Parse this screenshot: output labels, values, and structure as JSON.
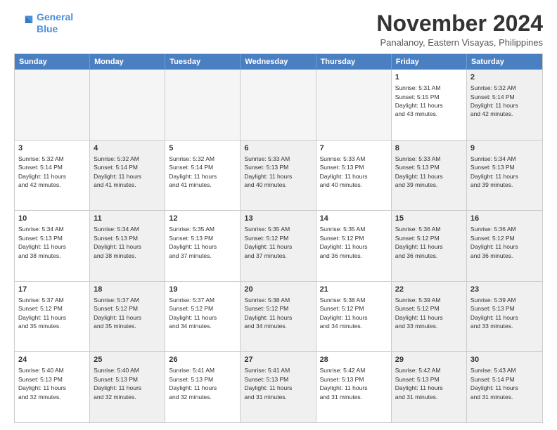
{
  "logo": {
    "line1": "General",
    "line2": "Blue"
  },
  "title": "November 2024",
  "location": "Panalanoy, Eastern Visayas, Philippines",
  "header_days": [
    "Sunday",
    "Monday",
    "Tuesday",
    "Wednesday",
    "Thursday",
    "Friday",
    "Saturday"
  ],
  "weeks": [
    [
      {
        "day": "",
        "info": "",
        "shaded": true
      },
      {
        "day": "",
        "info": "",
        "shaded": true
      },
      {
        "day": "",
        "info": "",
        "shaded": true
      },
      {
        "day": "",
        "info": "",
        "shaded": true
      },
      {
        "day": "",
        "info": "",
        "shaded": true
      },
      {
        "day": "1",
        "info": "Sunrise: 5:31 AM\nSunset: 5:15 PM\nDaylight: 11 hours\nand 43 minutes."
      },
      {
        "day": "2",
        "info": "Sunrise: 5:32 AM\nSunset: 5:14 PM\nDaylight: 11 hours\nand 42 minutes.",
        "shaded": true
      }
    ],
    [
      {
        "day": "3",
        "info": "Sunrise: 5:32 AM\nSunset: 5:14 PM\nDaylight: 11 hours\nand 42 minutes."
      },
      {
        "day": "4",
        "info": "Sunrise: 5:32 AM\nSunset: 5:14 PM\nDaylight: 11 hours\nand 41 minutes.",
        "shaded": true
      },
      {
        "day": "5",
        "info": "Sunrise: 5:32 AM\nSunset: 5:14 PM\nDaylight: 11 hours\nand 41 minutes."
      },
      {
        "day": "6",
        "info": "Sunrise: 5:33 AM\nSunset: 5:13 PM\nDaylight: 11 hours\nand 40 minutes.",
        "shaded": true
      },
      {
        "day": "7",
        "info": "Sunrise: 5:33 AM\nSunset: 5:13 PM\nDaylight: 11 hours\nand 40 minutes."
      },
      {
        "day": "8",
        "info": "Sunrise: 5:33 AM\nSunset: 5:13 PM\nDaylight: 11 hours\nand 39 minutes.",
        "shaded": true
      },
      {
        "day": "9",
        "info": "Sunrise: 5:34 AM\nSunset: 5:13 PM\nDaylight: 11 hours\nand 39 minutes.",
        "shaded": true
      }
    ],
    [
      {
        "day": "10",
        "info": "Sunrise: 5:34 AM\nSunset: 5:13 PM\nDaylight: 11 hours\nand 38 minutes."
      },
      {
        "day": "11",
        "info": "Sunrise: 5:34 AM\nSunset: 5:13 PM\nDaylight: 11 hours\nand 38 minutes.",
        "shaded": true
      },
      {
        "day": "12",
        "info": "Sunrise: 5:35 AM\nSunset: 5:13 PM\nDaylight: 11 hours\nand 37 minutes."
      },
      {
        "day": "13",
        "info": "Sunrise: 5:35 AM\nSunset: 5:12 PM\nDaylight: 11 hours\nand 37 minutes.",
        "shaded": true
      },
      {
        "day": "14",
        "info": "Sunrise: 5:35 AM\nSunset: 5:12 PM\nDaylight: 11 hours\nand 36 minutes."
      },
      {
        "day": "15",
        "info": "Sunrise: 5:36 AM\nSunset: 5:12 PM\nDaylight: 11 hours\nand 36 minutes.",
        "shaded": true
      },
      {
        "day": "16",
        "info": "Sunrise: 5:36 AM\nSunset: 5:12 PM\nDaylight: 11 hours\nand 36 minutes.",
        "shaded": true
      }
    ],
    [
      {
        "day": "17",
        "info": "Sunrise: 5:37 AM\nSunset: 5:12 PM\nDaylight: 11 hours\nand 35 minutes."
      },
      {
        "day": "18",
        "info": "Sunrise: 5:37 AM\nSunset: 5:12 PM\nDaylight: 11 hours\nand 35 minutes.",
        "shaded": true
      },
      {
        "day": "19",
        "info": "Sunrise: 5:37 AM\nSunset: 5:12 PM\nDaylight: 11 hours\nand 34 minutes."
      },
      {
        "day": "20",
        "info": "Sunrise: 5:38 AM\nSunset: 5:12 PM\nDaylight: 11 hours\nand 34 minutes.",
        "shaded": true
      },
      {
        "day": "21",
        "info": "Sunrise: 5:38 AM\nSunset: 5:12 PM\nDaylight: 11 hours\nand 34 minutes."
      },
      {
        "day": "22",
        "info": "Sunrise: 5:39 AM\nSunset: 5:12 PM\nDaylight: 11 hours\nand 33 minutes.",
        "shaded": true
      },
      {
        "day": "23",
        "info": "Sunrise: 5:39 AM\nSunset: 5:13 PM\nDaylight: 11 hours\nand 33 minutes.",
        "shaded": true
      }
    ],
    [
      {
        "day": "24",
        "info": "Sunrise: 5:40 AM\nSunset: 5:13 PM\nDaylight: 11 hours\nand 32 minutes."
      },
      {
        "day": "25",
        "info": "Sunrise: 5:40 AM\nSunset: 5:13 PM\nDaylight: 11 hours\nand 32 minutes.",
        "shaded": true
      },
      {
        "day": "26",
        "info": "Sunrise: 5:41 AM\nSunset: 5:13 PM\nDaylight: 11 hours\nand 32 minutes."
      },
      {
        "day": "27",
        "info": "Sunrise: 5:41 AM\nSunset: 5:13 PM\nDaylight: 11 hours\nand 31 minutes.",
        "shaded": true
      },
      {
        "day": "28",
        "info": "Sunrise: 5:42 AM\nSunset: 5:13 PM\nDaylight: 11 hours\nand 31 minutes."
      },
      {
        "day": "29",
        "info": "Sunrise: 5:42 AM\nSunset: 5:13 PM\nDaylight: 11 hours\nand 31 minutes.",
        "shaded": true
      },
      {
        "day": "30",
        "info": "Sunrise: 5:43 AM\nSunset: 5:14 PM\nDaylight: 11 hours\nand 31 minutes.",
        "shaded": true
      }
    ]
  ]
}
